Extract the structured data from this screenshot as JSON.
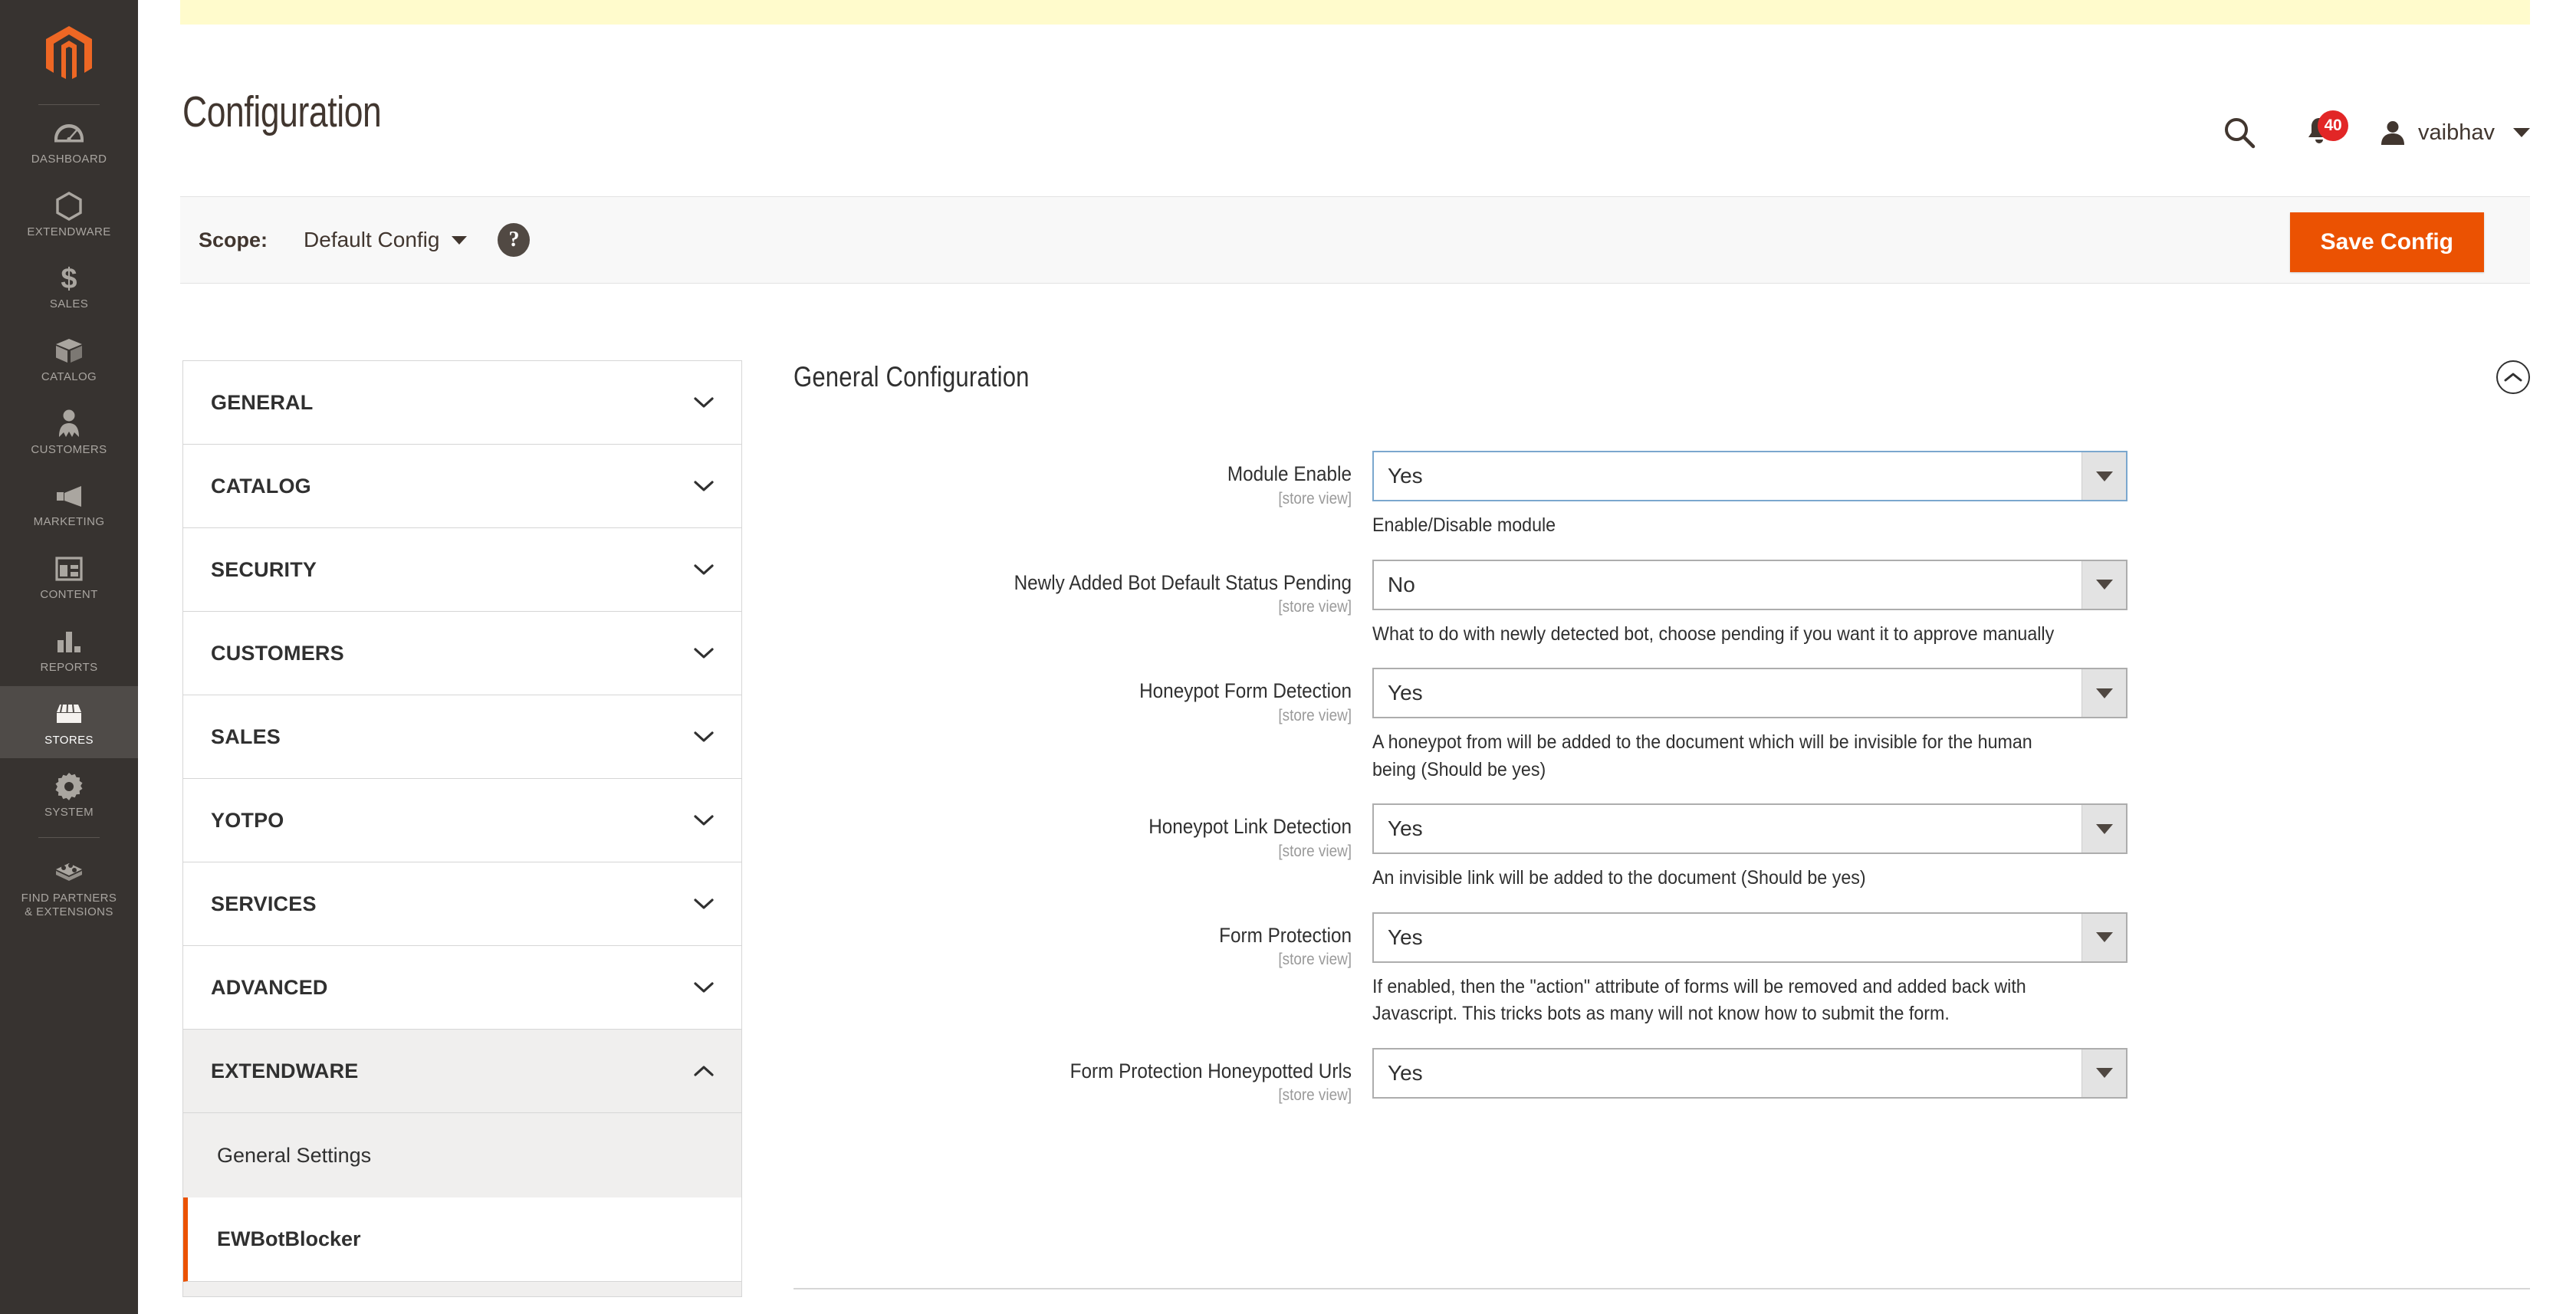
{
  "admin_nav": {
    "logo": "magento-logo",
    "items": [
      {
        "label": "DASHBOARD",
        "icon": "dashboard-icon",
        "active": false
      },
      {
        "label": "EXTENDWARE",
        "icon": "hexagon-icon",
        "active": false
      },
      {
        "label": "SALES",
        "icon": "dollar-icon",
        "active": false
      },
      {
        "label": "CATALOG",
        "icon": "box-icon",
        "active": false
      },
      {
        "label": "CUSTOMERS",
        "icon": "person-icon",
        "active": false
      },
      {
        "label": "MARKETING",
        "icon": "megaphone-icon",
        "active": false
      },
      {
        "label": "CONTENT",
        "icon": "layout-icon",
        "active": false
      },
      {
        "label": "REPORTS",
        "icon": "bar-chart-icon",
        "active": false
      },
      {
        "label": "STORES",
        "icon": "store-icon",
        "active": true
      },
      {
        "label": "SYSTEM",
        "icon": "gear-icon",
        "active": false
      },
      {
        "label": "FIND PARTNERS\n& EXTENSIONS",
        "icon": "extensions-icon",
        "active": false
      }
    ]
  },
  "header": {
    "title": "Configuration",
    "search_icon": "search-icon",
    "notifications_icon": "bell-icon",
    "notifications_count": "40",
    "avatar_icon": "user-avatar-icon",
    "user_name": "vaibhav",
    "user_caret": "chevron-down-icon"
  },
  "scope_bar": {
    "label": "Scope:",
    "value": "Default Config",
    "help_glyph": "?",
    "save_label": "Save Config"
  },
  "config_nav": {
    "sections": [
      {
        "label": "GENERAL",
        "expanded": false
      },
      {
        "label": "CATALOG",
        "expanded": false
      },
      {
        "label": "SECURITY",
        "expanded": false
      },
      {
        "label": "CUSTOMERS",
        "expanded": false
      },
      {
        "label": "SALES",
        "expanded": false
      },
      {
        "label": "YOTPO",
        "expanded": false
      },
      {
        "label": "SERVICES",
        "expanded": false
      },
      {
        "label": "ADVANCED",
        "expanded": false
      },
      {
        "label": "EXTENDWARE",
        "expanded": true
      }
    ],
    "sub_items": [
      {
        "label": "General Settings",
        "active": false
      },
      {
        "label": "EWBotBlocker",
        "active": true
      }
    ]
  },
  "main": {
    "section_title": "General Configuration",
    "collapse_icon": "chevron-up-circle-icon",
    "scope_note": "[store view]",
    "fields": [
      {
        "label": "Module Enable",
        "scope": "[store view]",
        "value": "Yes",
        "comment": "Enable/Disable module",
        "focused": true
      },
      {
        "label": "Newly Added Bot Default Status Pending",
        "scope": "[store view]",
        "value": "No",
        "comment": "What to do with newly detected bot, choose pending if you want it to approve manually",
        "focused": false
      },
      {
        "label": "Honeypot Form Detection",
        "scope": "[store view]",
        "value": "Yes",
        "comment": "A honeypot from will be added to the document which will be invisible for the human being (Should be yes)",
        "focused": false
      },
      {
        "label": "Honeypot Link Detection",
        "scope": "[store view]",
        "value": "Yes",
        "comment": "An invisible link will be added to the document (Should be yes)",
        "focused": false
      },
      {
        "label": "Form Protection",
        "scope": "[store view]",
        "value": "Yes",
        "comment": "If enabled, then the \"action\" attribute of forms will be removed and added back with Javascript. This tricks bots as many will not know how to submit the form.",
        "focused": false
      },
      {
        "label": "Form Protection Honeypotted Urls",
        "scope": "[store view]",
        "value": "Yes",
        "comment": "",
        "focused": false
      }
    ]
  },
  "colors": {
    "brand_orange": "#eb5202",
    "nav_dark": "#373330",
    "banner_yellow": "#fffbcc",
    "badge_red": "#e22626",
    "focus_blue": "#7ba7ce"
  }
}
